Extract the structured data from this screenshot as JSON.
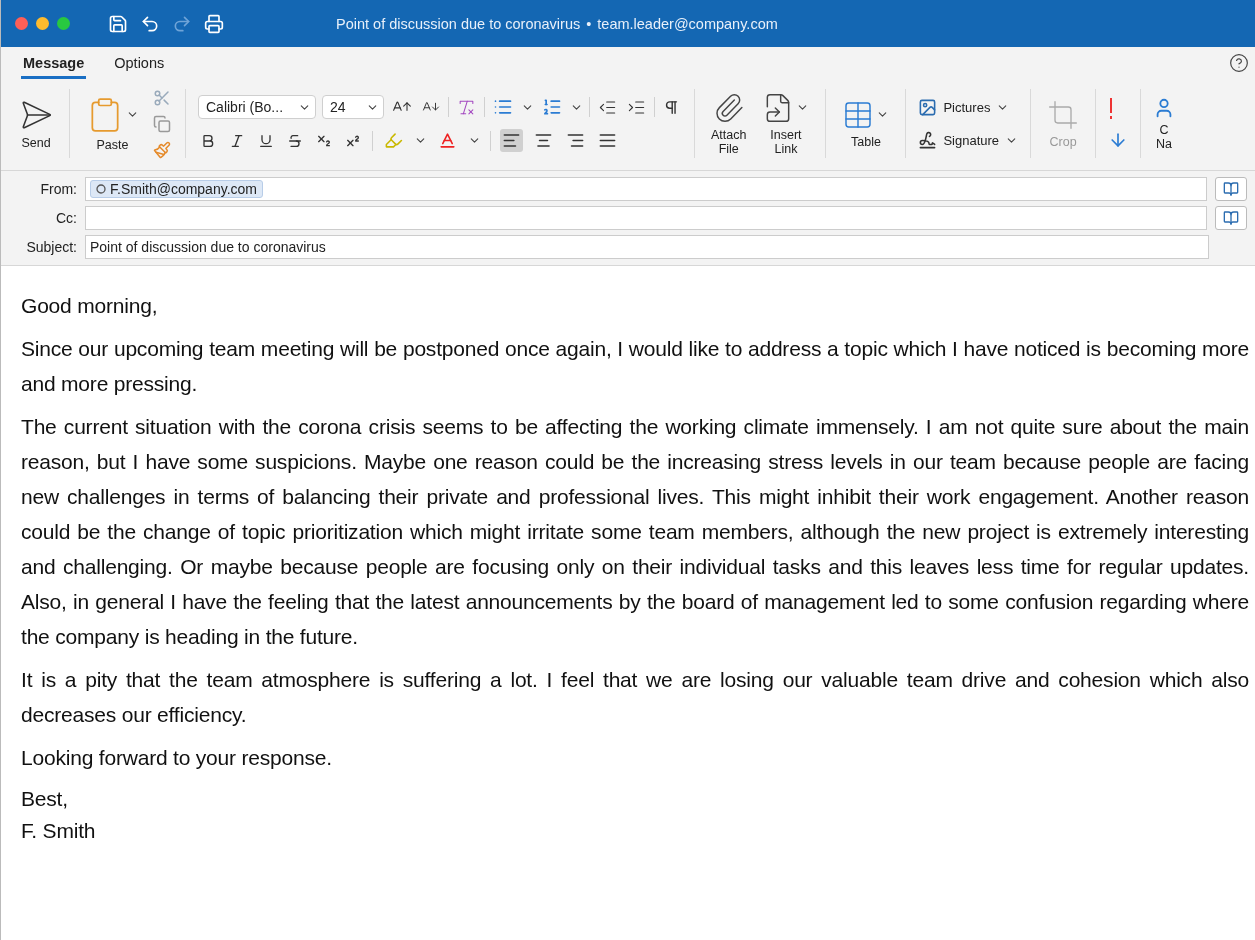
{
  "title_bar": {
    "subject": "Point of discussion due to coronavirus",
    "separator": "•",
    "account": "team.leader@company.com"
  },
  "tabs": [
    {
      "label": "Message",
      "selected": true
    },
    {
      "label": "Options",
      "selected": false
    }
  ],
  "ribbon": {
    "send": "Send",
    "paste": "Paste",
    "font": {
      "name": "Calibri (Bo...",
      "size": "24"
    },
    "attach": [
      "Attach",
      "File"
    ],
    "insert_link": [
      "Insert",
      "Link"
    ],
    "table": "Table",
    "pictures": "Pictures",
    "signature": "Signature",
    "crop": {
      "label": "Crop",
      "disabled": true
    },
    "cut_off": [
      "C",
      "Na"
    ]
  },
  "header_fields": [
    {
      "label": "From:",
      "kind": "chip",
      "value": "F.Smith@company.com",
      "book": true
    },
    {
      "label": "Cc:",
      "kind": "empty",
      "book": true
    },
    {
      "label": "Subject:",
      "kind": "text",
      "value": "Point of discussion due to coronavirus",
      "book": false
    }
  ],
  "body": {
    "greeting": "Good morning,",
    "paragraphs": [
      "Since our upcoming team meeting will be postponed once again, I would like to address a topic which I have noticed is becoming more and more pressing.",
      "The current situation with the corona crisis seems to be affecting the working climate immensely. I am not quite sure about the main reason, but I have some suspicions. Maybe one reason could be the increasing stress levels in our team because people are facing new challenges in terms of balancing their private and professional lives. This might inhibit their work engagement. Another reason could be the change of topic prioritization which might irritate some team members, although the new project is extremely interesting and challenging. Or maybe because people are focusing only on their individual tasks and this leaves less time for regular updates. Also, in general I have the feeling that the latest announcements by the board of management led to some confusion regarding where the company is heading in the future.",
      "It is a pity that the team atmosphere is suffering a lot. I feel that we are losing our valuable team drive and cohesion which also decreases our efficiency.",
      "Looking forward to your response."
    ],
    "closing": [
      "Best,",
      "F. Smith"
    ]
  }
}
